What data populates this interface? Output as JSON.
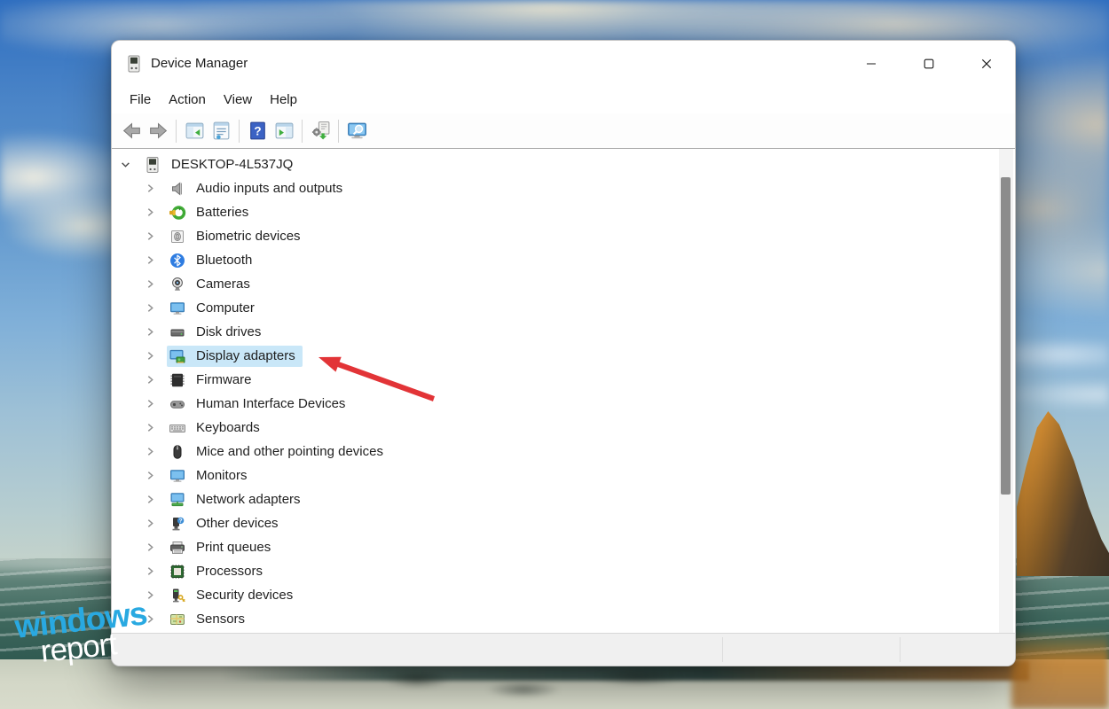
{
  "window": {
    "title": "Device Manager"
  },
  "menu": {
    "items": [
      "File",
      "Action",
      "View",
      "Help"
    ]
  },
  "toolbar": {
    "groups": [
      [
        {
          "name": "back",
          "icon": "back-icon"
        },
        {
          "name": "forward",
          "icon": "forward-icon"
        }
      ],
      [
        {
          "name": "show-hide-console-tree",
          "icon": "console-tree-icon"
        },
        {
          "name": "properties",
          "icon": "properties-icon"
        }
      ],
      [
        {
          "name": "help",
          "icon": "help-icon"
        },
        {
          "name": "show-hide-action-pane",
          "icon": "action-pane-icon"
        }
      ],
      [
        {
          "name": "scan-for-hardware-changes",
          "icon": "scan-hardware-icon"
        }
      ],
      [
        {
          "name": "scan-computer",
          "icon": "scan-monitor-icon"
        }
      ]
    ]
  },
  "tree": {
    "root": {
      "label": "DESKTOP-4L537JQ",
      "icon": "device-manager-icon",
      "expanded": true
    },
    "items": [
      {
        "label": "Audio inputs and outputs",
        "icon": "audio-device-icon"
      },
      {
        "label": "Batteries",
        "icon": "battery-icon"
      },
      {
        "label": "Biometric devices",
        "icon": "biometric-icon"
      },
      {
        "label": "Bluetooth",
        "icon": "bluetooth-icon"
      },
      {
        "label": "Cameras",
        "icon": "camera-icon"
      },
      {
        "label": "Computer",
        "icon": "computer-icon"
      },
      {
        "label": "Disk drives",
        "icon": "disk-drive-icon"
      },
      {
        "label": "Display adapters",
        "icon": "display-adapter-icon",
        "selected": true,
        "annotated": true
      },
      {
        "label": "Firmware",
        "icon": "firmware-icon"
      },
      {
        "label": "Human Interface Devices",
        "icon": "hid-icon"
      },
      {
        "label": "Keyboards",
        "icon": "keyboard-icon"
      },
      {
        "label": "Mice and other pointing devices",
        "icon": "mouse-icon"
      },
      {
        "label": "Monitors",
        "icon": "monitor-icon"
      },
      {
        "label": "Network adapters",
        "icon": "network-adapter-icon"
      },
      {
        "label": "Other devices",
        "icon": "other-device-icon"
      },
      {
        "label": "Print queues",
        "icon": "printer-icon"
      },
      {
        "label": "Processors",
        "icon": "processor-icon"
      },
      {
        "label": "Security devices",
        "icon": "security-device-icon"
      },
      {
        "label": "Sensors",
        "icon": "sensor-icon"
      }
    ]
  },
  "watermark": {
    "line1": "windows",
    "line2": "report"
  },
  "colors": {
    "selection_highlight": "#c9e7f8",
    "annotation_arrow": "#e23437",
    "watermark_blue": "#29a9e1"
  }
}
